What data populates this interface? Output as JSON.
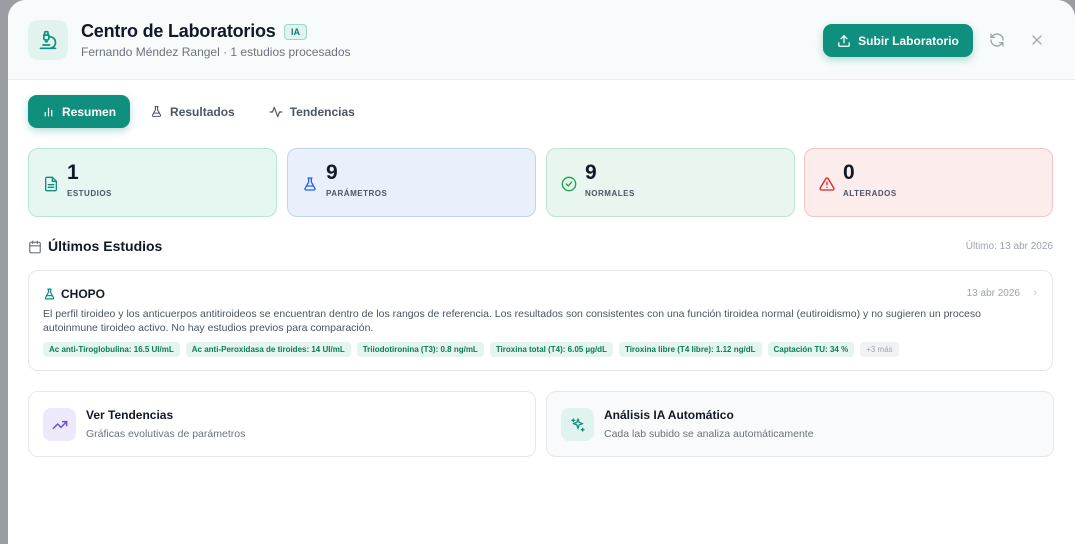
{
  "header": {
    "title": "Centro de Laboratorios",
    "badge": "IA",
    "subtitle": "Fernando Méndez Rangel · 1 estudios procesados",
    "upload_label": "Subir Laboratorio"
  },
  "tabs": [
    {
      "label": "Resumen"
    },
    {
      "label": "Resultados"
    },
    {
      "label": "Tendencias"
    }
  ],
  "stats": [
    {
      "value": "1",
      "label": "ESTUDIOS"
    },
    {
      "value": "9",
      "label": "PARÁMETROS"
    },
    {
      "value": "9",
      "label": "NORMALES"
    },
    {
      "value": "0",
      "label": "ALTERADOS"
    }
  ],
  "recent": {
    "title": "Últimos Estudios",
    "last": "Último: 13 abr 2026"
  },
  "study": {
    "name": "CHOPO",
    "date": "13 abr 2026",
    "description": "El perfil tiroideo y los anticuerpos antitiroideos se encuentran dentro de los rangos de referencia. Los resultados son consistentes con una función tiroidea normal (eutiroidismo) y no sugieren un proceso autoinmune tiroideo activo. No hay estudios previos para comparación.",
    "chips": [
      "Ac anti-Tiroglobulina: 16.5 UI/mL",
      "Ac anti-Peroxidasa de tiroides: 14 UI/mL",
      "Triiodotironina (T3): 0.8 ng/mL",
      "Tiroxina total (T4): 6.05 µg/dL",
      "Tiroxina libre (T4 libre): 1.12 ng/dL",
      "Captación TU: 34 %"
    ],
    "more": "+3 más"
  },
  "cards": [
    {
      "title": "Ver Tendencias",
      "desc": "Gráficas evolutivas de parámetros"
    },
    {
      "title": "Análisis IA Automático",
      "desc": "Cada lab subido se analiza automáticamente"
    }
  ],
  "colors": {
    "primary": "#0f8f7d",
    "normal": "#16a34a",
    "altered": "#dc2626",
    "params": "#2563eb"
  }
}
